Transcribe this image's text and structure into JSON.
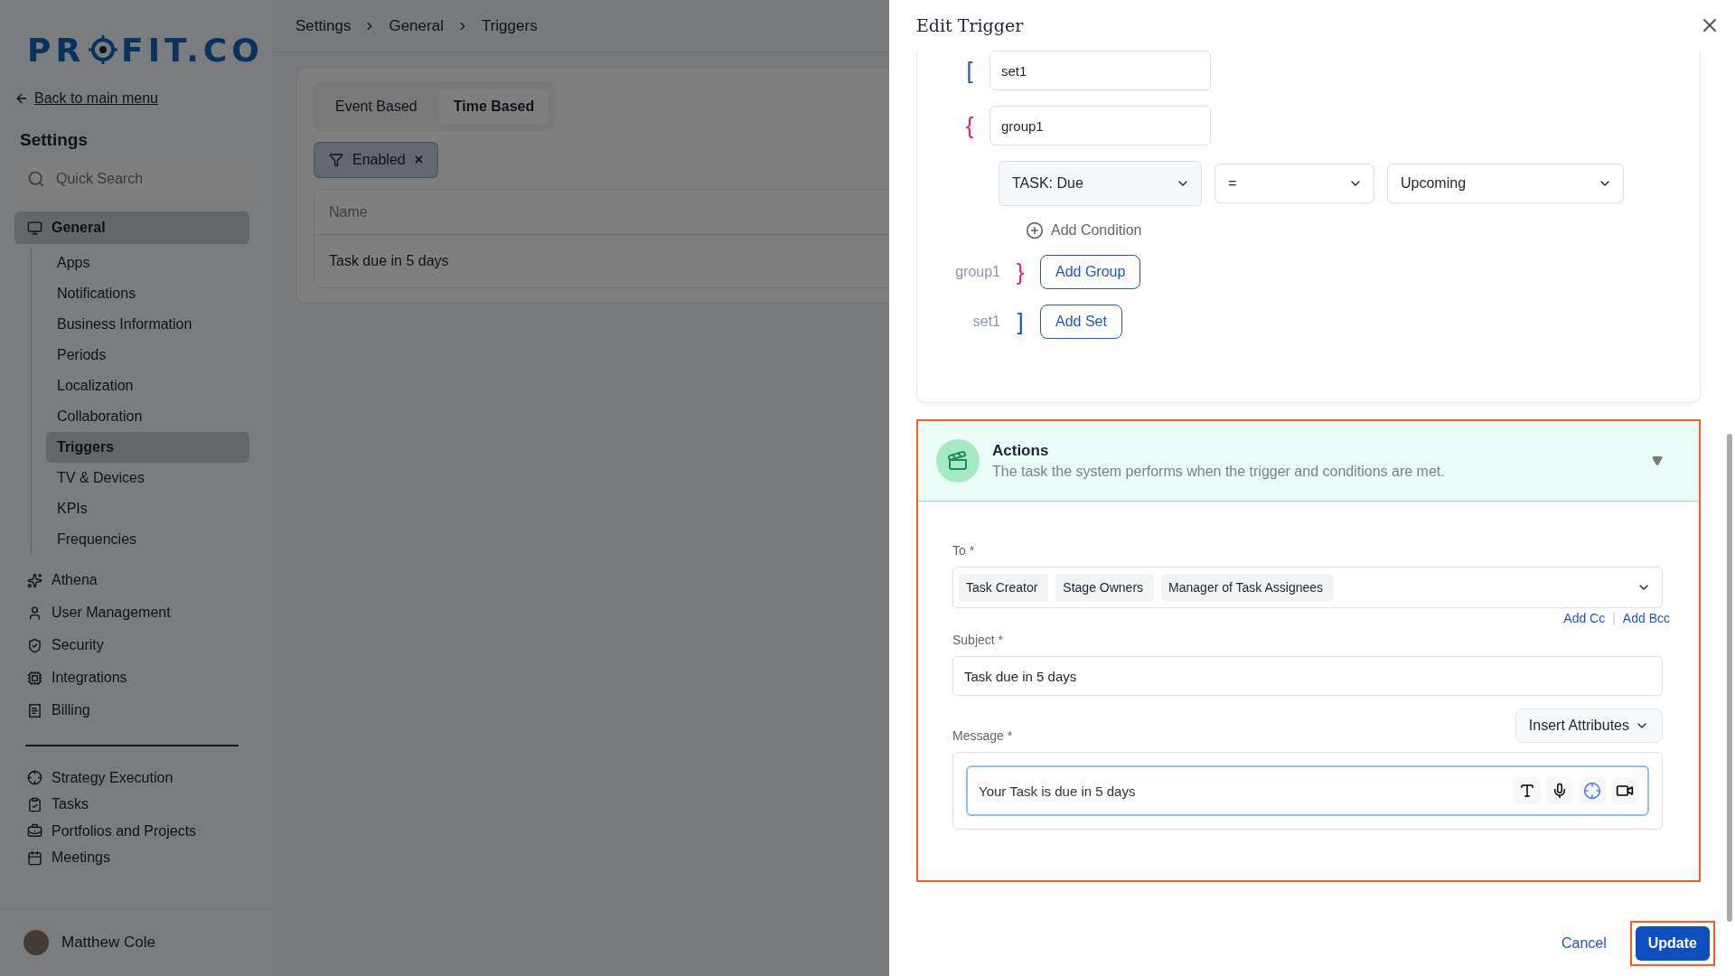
{
  "logo": {
    "before": "PR",
    "after": "FIT.CO"
  },
  "back_link": "Back to main menu",
  "sidebar": {
    "title": "Settings",
    "search": {
      "placeholder": "Quick Search"
    },
    "items": [
      {
        "label": "General",
        "expanded": true,
        "selected": true,
        "children": [
          {
            "label": "Apps",
            "selected": false
          },
          {
            "label": "Notifications",
            "selected": false
          },
          {
            "label": "Business Information",
            "selected": false
          },
          {
            "label": "Periods",
            "selected": false
          },
          {
            "label": "Localization",
            "selected": false
          },
          {
            "label": "Collaboration",
            "selected": false
          },
          {
            "label": "Triggers",
            "selected": true
          },
          {
            "label": "TV & Devices",
            "selected": false
          },
          {
            "label": "KPIs",
            "selected": false
          },
          {
            "label": "Frequencies",
            "selected": false
          }
        ]
      },
      {
        "label": "Athena",
        "selected": false
      },
      {
        "label": "User Management",
        "selected": false
      },
      {
        "label": "Security",
        "selected": false
      },
      {
        "label": "Integrations",
        "selected": false
      },
      {
        "label": "Billing",
        "selected": false
      }
    ],
    "apps": [
      {
        "label": "Strategy Execution"
      },
      {
        "label": "Tasks"
      },
      {
        "label": "Portfolios and Projects"
      },
      {
        "label": "Meetings"
      }
    ],
    "user": {
      "name": "Matthew Cole"
    }
  },
  "breadcrumb": [
    "Settings",
    "General",
    "Triggers"
  ],
  "tabs": [
    {
      "label": "Event Based",
      "selected": false
    },
    {
      "label": "Time Based",
      "selected": true
    }
  ],
  "filter_chip": {
    "label": "Enabled",
    "remove": "×"
  },
  "table": {
    "columns": [
      "Name"
    ],
    "rows": [
      [
        "Task due in 5 days"
      ]
    ]
  },
  "drawer": {
    "title": "Edit Trigger",
    "conditions": {
      "set_open": "[",
      "group_open": "{",
      "group_close": "}",
      "set_close": "]",
      "set_name": "set1",
      "group_name": "group1",
      "condition": {
        "field": "TASK: Due",
        "operator": "=",
        "value": "Upcoming"
      },
      "add_condition": "Add Condition",
      "group_close_label": "group1",
      "add_group": "Add Group",
      "set_close_label": "set1",
      "add_set": "Add Set"
    },
    "actions": {
      "title": "Actions",
      "subtitle": "The task the system performs when the trigger and conditions are met.",
      "highlighted": true,
      "to_label": "To *",
      "recipients": [
        "Task Creator",
        "Stage Owners",
        "Manager of Task Assignees"
      ],
      "add_cc": "Add Cc",
      "link_separator": "|",
      "add_bcc": "Add Bcc",
      "subject_label": "Subject *",
      "subject": "Task due in 5 days",
      "message_label": "Message *",
      "insert_attributes": "Insert Attributes",
      "message": "Your Task is due in 5 days"
    },
    "footer": {
      "cancel": "Cancel",
      "update": "Update",
      "update_highlighted": true
    }
  }
}
